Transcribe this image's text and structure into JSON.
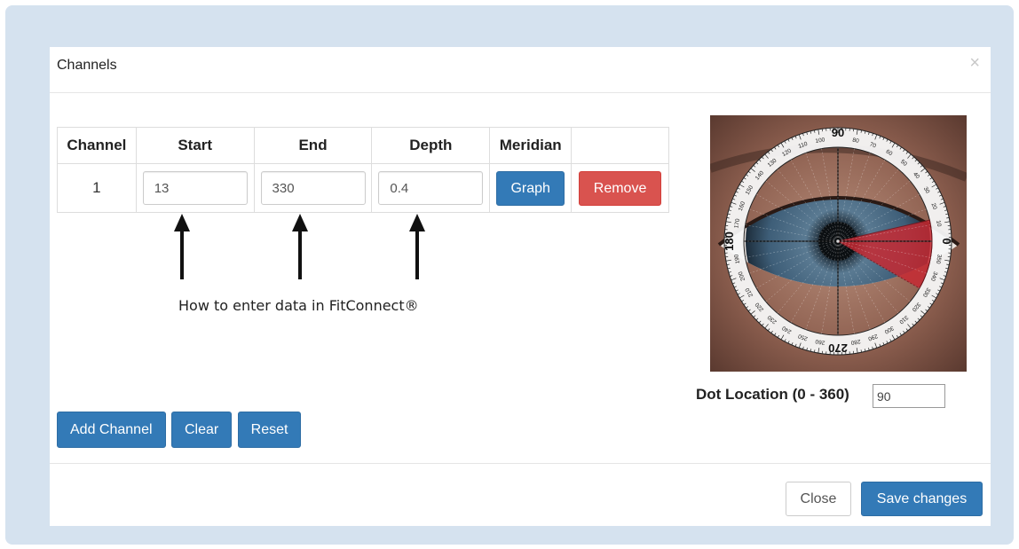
{
  "dialog": {
    "title": "Channels",
    "close_glyph": "×"
  },
  "table": {
    "headers": [
      "Channel",
      "Start",
      "End",
      "Depth",
      "Meridian",
      ""
    ],
    "rows": [
      {
        "channel": "1",
        "start": "13",
        "end": "330",
        "depth": "0.4",
        "graph_label": "Graph",
        "remove_label": "Remove"
      }
    ]
  },
  "annotation": {
    "caption": "How to enter data in FitConnect®"
  },
  "dial": {
    "image": "eye-photo-with-degree-dial",
    "label_90": "90",
    "label_180": "180",
    "label_270": "270",
    "label_0": "0",
    "wedge_start_deg": 13,
    "wedge_end_deg": 330
  },
  "dot_location": {
    "label": "Dot Location (0 - 360)",
    "value": "90"
  },
  "actions": {
    "add_channel": "Add Channel",
    "clear": "Clear",
    "reset": "Reset"
  },
  "footer": {
    "close": "Close",
    "save": "Save changes"
  },
  "colors": {
    "primary": "#337ab7",
    "danger": "#d9534f",
    "frame": "#d5e2ef",
    "wedge": "#c62a33"
  }
}
